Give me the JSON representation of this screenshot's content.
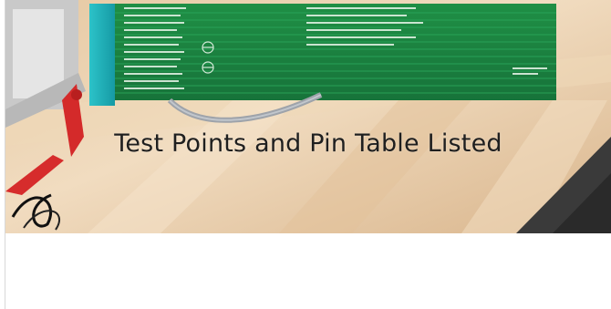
{
  "image": {
    "caption": "Test Points and Pin Table Listed"
  }
}
